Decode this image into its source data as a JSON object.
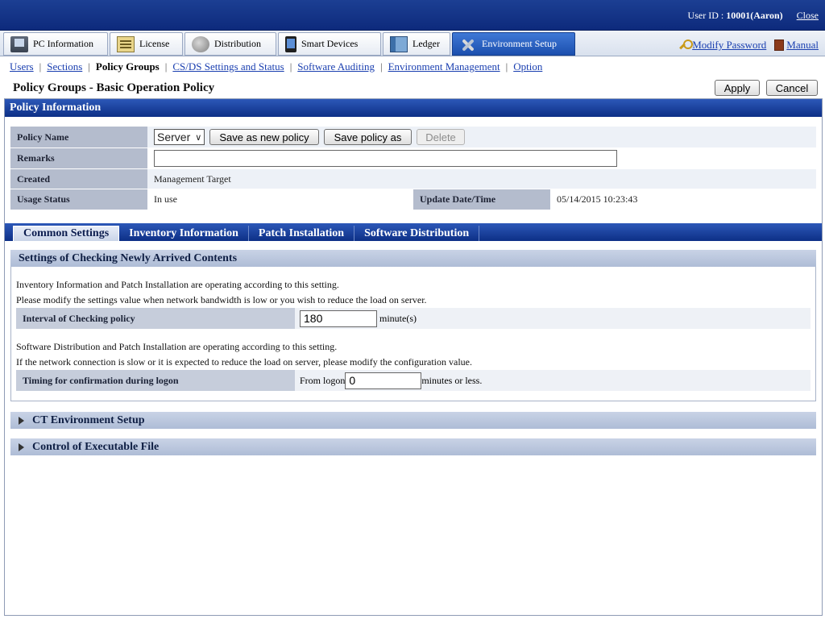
{
  "header": {
    "user_label": "User ID : ",
    "user_id": "10001(Aaron)",
    "close_label": "Close"
  },
  "main_tabs": [
    {
      "label": "PC Information",
      "icon": "pc-icon"
    },
    {
      "label": "License",
      "icon": "license-icon"
    },
    {
      "label": "Distribution",
      "icon": "distribution-icon"
    },
    {
      "label": "Smart Devices",
      "icon": "smart-device-icon"
    },
    {
      "label": "Ledger",
      "icon": "ledger-icon"
    },
    {
      "label": "Environment Setup",
      "icon": "environment-setup-icon",
      "active": true
    }
  ],
  "top_links": {
    "modify_password": "Modify Password",
    "manual": "Manual"
  },
  "subnav": {
    "users": "Users",
    "sections": "Sections",
    "policy_groups": "Policy Groups",
    "csds": "CS/DS Settings and Status",
    "software_auditing": "Software Auditing",
    "environment_management": "Environment Management",
    "option": "Option"
  },
  "page": {
    "title": "Policy Groups - Basic Operation Policy",
    "apply": "Apply",
    "cancel": "Cancel"
  },
  "policy_info": {
    "section_title": "Policy Information",
    "policy_name_label": "Policy Name",
    "policy_name_value": "Server",
    "save_new": "Save as new policy",
    "save_as": "Save policy as",
    "delete": "Delete",
    "remarks_label": "Remarks",
    "remarks_value": "",
    "created_label": "Created",
    "created_value": "Management Target",
    "usage_label": "Usage Status",
    "usage_value": "In use",
    "update_label": "Update Date/Time",
    "update_value": "05/14/2015 10:23:43"
  },
  "content_tabs": [
    {
      "label": "Common Settings",
      "active": true
    },
    {
      "label": "Inventory Information"
    },
    {
      "label": "Patch Installation"
    },
    {
      "label": "Software Distribution"
    }
  ],
  "checking": {
    "title": "Settings of Checking Newly Arrived Contents",
    "note1": "Inventory Information and Patch Installation are operating according to this setting.",
    "note2": "Please modify the settings value when network bandwidth is low or you wish to reduce the load on server.",
    "interval_label": "Interval of Checking policy",
    "interval_value": "180",
    "interval_unit": "minute(s)",
    "note3": "Software Distribution and Patch Installation are operating according to this setting.",
    "note4": "If the network connection is slow or it is expected to reduce the load on server, please modify the configuration value.",
    "timing_label": "Timing for confirmation during logon",
    "timing_prefix": "From logon",
    "timing_value": "0",
    "timing_suffix": "minutes or less."
  },
  "collapsed_sections": {
    "ct_env": "CT Environment Setup",
    "exec_file": "Control of Executable File"
  }
}
